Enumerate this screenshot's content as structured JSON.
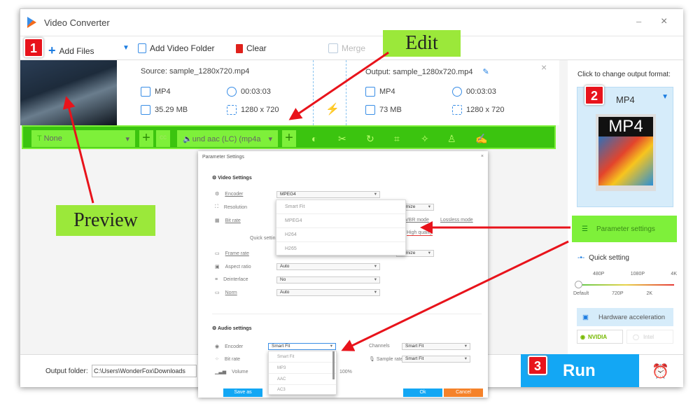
{
  "window": {
    "title": "Video Converter",
    "minimize": "–",
    "close": "×"
  },
  "toolbar": {
    "add_files": "Add Files",
    "add_video_folder": "Add Video Folder",
    "clear": "Clear",
    "merge": "Merge"
  },
  "file": {
    "source": "Source: sample_1280x720.mp4",
    "output": "Output: sample_1280x720.mp4",
    "src_format": "MP4",
    "src_duration": "00:03:03",
    "src_size": "35.29 MB",
    "src_resolution": "1280 x 720",
    "out_format": "MP4",
    "out_duration": "00:03:03",
    "out_size": "73 MB",
    "out_resolution": "1280 x 720",
    "remove": "×"
  },
  "edit_bar": {
    "subtitle": "None",
    "audio": "und aac (LC) (mp4a",
    "plus": "+",
    "cc": "cc"
  },
  "right_panel": {
    "hint": "Click to change output format:",
    "format": "MP4",
    "format_icon_text": "MP4",
    "parameter_settings": "Parameter settings",
    "quick_setting": "Quick setting",
    "slider_top": [
      "480P",
      "1080P",
      "4K"
    ],
    "slider_bottom": [
      "Default",
      "720P",
      "2K"
    ],
    "slider_value": 0,
    "hw_accel": "Hardware acceleration",
    "nvidia": "NVIDIA",
    "intel": "Intel"
  },
  "bottom": {
    "output_folder_label": "Output folder:",
    "output_folder_value": "C:\\Users\\WonderFox\\Downloads",
    "run": "Run"
  },
  "annotations": {
    "badge1": "1",
    "badge2": "2",
    "badge3": "3",
    "edit": "Edit",
    "preview": "Preview"
  },
  "dialog": {
    "title": "Parameter Settings",
    "close": "×",
    "video_settings": "Video Settings",
    "encoder_label": "Encoder",
    "encoder_value": "MPEG4",
    "encoder_options": [
      "Smart Fit",
      "MPEG4",
      "H264",
      "H265"
    ],
    "resolution_label": "Resolution",
    "customize": "stomize",
    "bitrate_label": "Bit rate",
    "vbr": "VBR mode",
    "lossless": "Lossless mode",
    "quick_setting": "Quick settin",
    "high_quality": "High quality",
    "framerate_label": "Frame rate",
    "customize2": "stomize",
    "aspect_label": "Aspect ratio",
    "aspect_value": "Auto",
    "deinterlace_label": "Deinterlace",
    "deinterlace_value": "No",
    "norm_label": "Norm",
    "norm_value": "Auto",
    "audio_settings": "Audio settings",
    "a_encoder_label": "Encoder",
    "a_encoder_value": "Smart Fit",
    "a_encoder_options": [
      "Smart Fit",
      "MP3",
      "AAC",
      "AC3"
    ],
    "channels_label": "Channels",
    "channels_value": "Smart Fit",
    "a_bitrate_label": "Bit rate",
    "sample_rate_label": "Sample rate",
    "sample_rate_value": "Smart Fit",
    "volume_label": "Volume",
    "volume_value": "100%",
    "save_as": "Save as",
    "ok": "Ok",
    "cancel": "Cancel"
  },
  "colors": {
    "accent": "#13a7f4",
    "highlight": "#7ef03a",
    "annotation": "#e8131b",
    "cancel": "#f5822a"
  }
}
